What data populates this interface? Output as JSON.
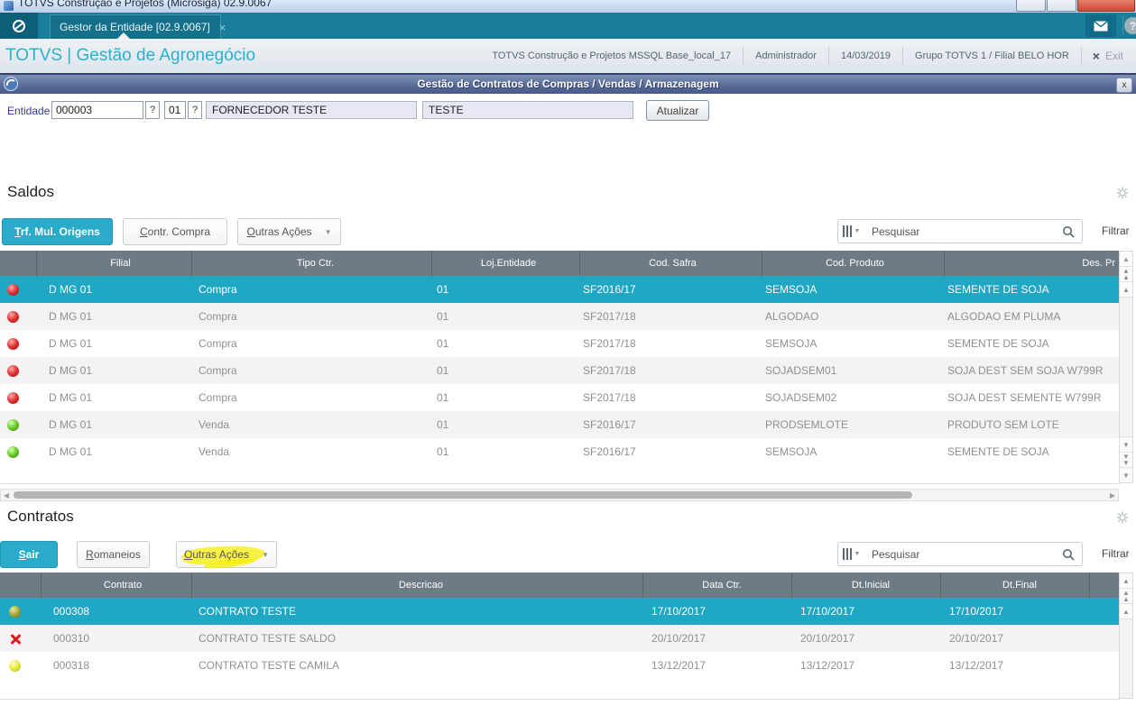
{
  "window": {
    "title": "TOTVS Construção e Projetos (Microsiga) 02.9.0067"
  },
  "tabbar": {
    "tab_label": "Gestor da Entidade [02.9.0067]"
  },
  "header": {
    "app_title": "TOTVS | Gestão de Agronegócio",
    "environment": "TOTVS Construção e Projetos MSSQL Base_local_17",
    "user": "Administrador",
    "date": "14/03/2019",
    "group": "Grupo TOTVS 1 / Filial BELO HOR",
    "exit_label": "Exit"
  },
  "dialog": {
    "title": "Gestão de Contratos de Compras / Vendas / Armazenagem"
  },
  "entity": {
    "label": "Entidade",
    "code": "000003",
    "store": "01",
    "name": "FORNECEDOR TESTE",
    "nickname": "TESTE",
    "update_button": "Atualizar"
  },
  "saldos": {
    "title": "Saldos",
    "buttons": {
      "primary": "Trf. Mul. Origens",
      "secondary": "Contr. Compra",
      "more": "Outras Ações"
    },
    "search_placeholder": "Pesquisar",
    "filter_label": "Filtrar",
    "columns": [
      "",
      "Filial",
      "Tipo Ctr.",
      "Loj.Entidade",
      "Cod. Safra",
      "Cod. Produto",
      "Des. Pr"
    ],
    "rows": [
      {
        "status": "red",
        "selected": true,
        "filial": "D MG 01",
        "tipo": "Compra",
        "loja": "01",
        "safra": "SF2016/17",
        "produto": "SEMSOJA",
        "descricao": "SEMENTE DE SOJA"
      },
      {
        "status": "red",
        "selected": false,
        "filial": "D MG 01",
        "tipo": "Compra",
        "loja": "01",
        "safra": "SF2017/18",
        "produto": "ALGODAO",
        "descricao": "ALGODAO EM PLUMA"
      },
      {
        "status": "red",
        "selected": false,
        "filial": "D MG 01",
        "tipo": "Compra",
        "loja": "01",
        "safra": "SF2017/18",
        "produto": "SEMSOJA",
        "descricao": "SEMENTE DE SOJA"
      },
      {
        "status": "red",
        "selected": false,
        "filial": "D MG 01",
        "tipo": "Compra",
        "loja": "01",
        "safra": "SF2017/18",
        "produto": "SOJADSEM01",
        "descricao": "SOJA DEST SEM SOJA W799R"
      },
      {
        "status": "red",
        "selected": false,
        "filial": "D MG 01",
        "tipo": "Compra",
        "loja": "01",
        "safra": "SF2017/18",
        "produto": "SOJADSEM02",
        "descricao": "SOJA DEST SEMENTE W799R"
      },
      {
        "status": "green",
        "selected": false,
        "filial": "D MG 01",
        "tipo": "Venda",
        "loja": "01",
        "safra": "SF2016/17",
        "produto": "PRODSEMLOTE",
        "descricao": "PRODUTO SEM LOTE"
      },
      {
        "status": "green",
        "selected": false,
        "filial": "D MG 01",
        "tipo": "Venda",
        "loja": "01",
        "safra": "SF2016/17",
        "produto": "SEMSOJA",
        "descricao": "SEMENTE DE SOJA"
      }
    ]
  },
  "contratos": {
    "title": "Contratos",
    "buttons": {
      "primary": "Sair",
      "secondary": "Romaneios",
      "more": "Outras Ações"
    },
    "more_highlighted": true,
    "search_placeholder": "Pesquisar",
    "filter_label": "Filtrar",
    "columns": [
      "",
      "Contrato",
      "Descricao",
      "Data Ctr.",
      "Dt.Inicial",
      "Dt.Final",
      ""
    ],
    "rows": [
      {
        "status": "olive",
        "selected": true,
        "contrato": "000308",
        "descricao": "CONTRATO TESTE",
        "data_ctr": "17/10/2017",
        "dt_inicial": "17/10/2017",
        "dt_final": "17/10/2017"
      },
      {
        "status": "x",
        "selected": false,
        "contrato": "000310",
        "descricao": "CONTRATO TESTE SALDO",
        "data_ctr": "20/10/2017",
        "dt_inicial": "20/10/2017",
        "dt_final": "20/10/2017"
      },
      {
        "status": "yellow",
        "selected": false,
        "contrato": "000318",
        "descricao": "CONTRATO TESTE CAMILA",
        "data_ctr": "13/12/2017",
        "dt_inicial": "13/12/2017",
        "dt_final": "13/12/2017"
      }
    ]
  },
  "icons": {
    "tab_close": "×",
    "dialog_close": "x",
    "exit_x": "×",
    "help": "?",
    "lookup": "?",
    "dropdown": "▼",
    "up": "▲",
    "down": "▼",
    "left": "◀",
    "right": "▶"
  },
  "colors": {
    "accent_teal": "#29abc9",
    "selected_row": "#1fa7c4",
    "grid_header": "#6e7a84",
    "tab_bar": "#1a7d99",
    "dialog_bar": "#5a6d97",
    "highlight": "#f8ee00",
    "status_red": "#df3030",
    "status_green": "#66c928",
    "status_olive": "#a8a838",
    "status_yellow": "#e7e73a",
    "status_x": "#e01919"
  }
}
